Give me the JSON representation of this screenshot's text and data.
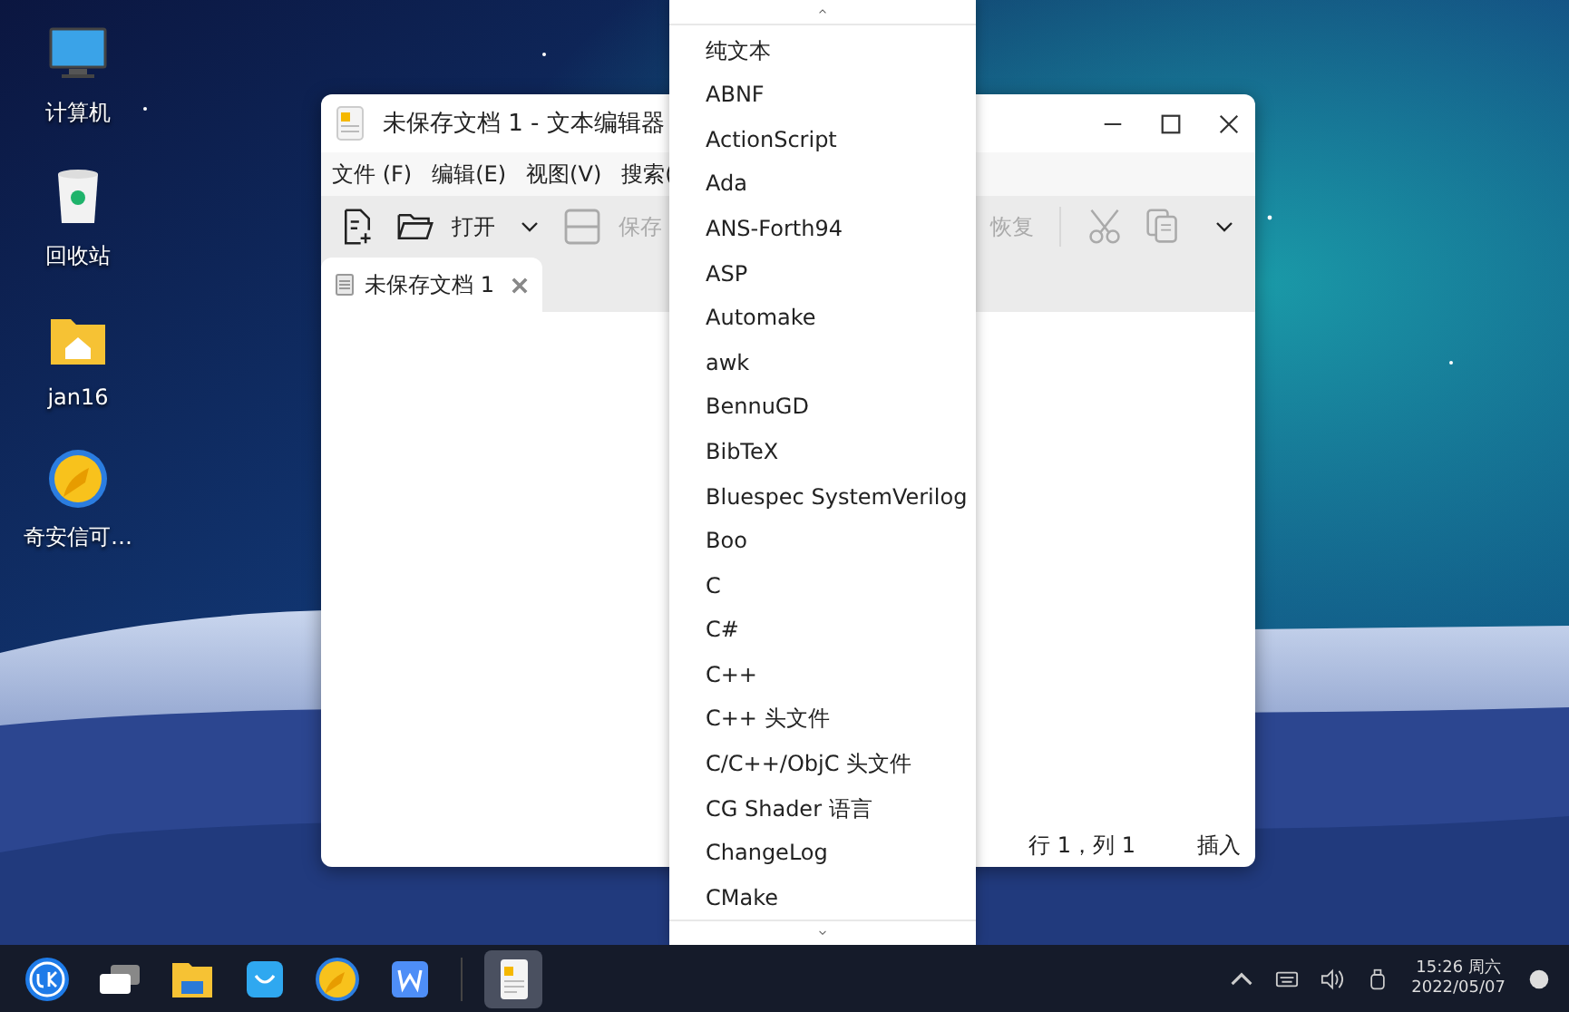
{
  "desktop_icons": [
    {
      "label": "计算机",
      "kind": "computer"
    },
    {
      "label": "回收站",
      "kind": "trash"
    },
    {
      "label": "jan16",
      "kind": "home"
    },
    {
      "label": "奇安信可…",
      "kind": "browser"
    }
  ],
  "window": {
    "title": "未保存文档 1 - 文本编辑器",
    "menu": [
      "文件 (F)",
      "编辑(E)",
      "视图(V)",
      "搜索("
    ],
    "toolbar": [
      {
        "kind": "new",
        "disabled": false
      },
      {
        "kind": "open",
        "label": "打开",
        "disabled": false
      },
      {
        "kind": "caret",
        "disabled": false
      },
      {
        "kind": "save",
        "label": "保存",
        "disabled": true
      },
      {
        "kind": "gap"
      },
      {
        "kind": "redo",
        "label": "恢复",
        "disabled": true
      },
      {
        "kind": "sep"
      },
      {
        "kind": "cut",
        "disabled": true
      },
      {
        "kind": "copy",
        "disabled": true
      },
      {
        "kind": "more",
        "disabled": false
      }
    ],
    "tabs": [
      {
        "label": "未保存文档 1",
        "selected": true
      }
    ],
    "status_bar": {
      "position": "行 1，列 1",
      "mode": "插入"
    }
  },
  "language_menu": {
    "items": [
      {
        "label": "纯文本",
        "selected": false
      },
      {
        "label": "ABNF",
        "selected": false
      },
      {
        "label": "ActionScript",
        "selected": false
      },
      {
        "label": "Ada",
        "selected": false
      },
      {
        "label": "ANS-Forth94",
        "selected": false
      },
      {
        "label": "ASP",
        "selected": false
      },
      {
        "label": "Automake",
        "selected": false
      },
      {
        "label": "awk",
        "selected": false
      },
      {
        "label": "BennuGD",
        "selected": false
      },
      {
        "label": "BibTeX",
        "selected": false
      },
      {
        "label": "Bluespec SystemVerilog",
        "selected": false
      },
      {
        "label": "Boo",
        "selected": false
      },
      {
        "label": "C",
        "selected": false
      },
      {
        "label": "C#",
        "selected": false
      },
      {
        "label": "C++",
        "selected": false
      },
      {
        "label": "C++ 头文件",
        "selected": false
      },
      {
        "label": "C/C++/ObjC 头文件",
        "selected": false
      },
      {
        "label": "CG Shader 语言",
        "selected": false
      },
      {
        "label": "ChangeLog",
        "selected": false
      },
      {
        "label": "CMake",
        "selected": false
      }
    ]
  },
  "taskbar": {
    "apps": [
      {
        "kind": "start",
        "active": false
      },
      {
        "kind": "multitask",
        "active": false
      },
      {
        "kind": "files",
        "active": false
      },
      {
        "kind": "store",
        "active": false
      },
      {
        "kind": "browser",
        "active": false
      },
      {
        "kind": "wps",
        "active": false
      },
      {
        "kind": "sep"
      },
      {
        "kind": "editor",
        "active": true
      }
    ],
    "clock": {
      "time": "15:26 周六",
      "date": "2022/05/07"
    }
  }
}
